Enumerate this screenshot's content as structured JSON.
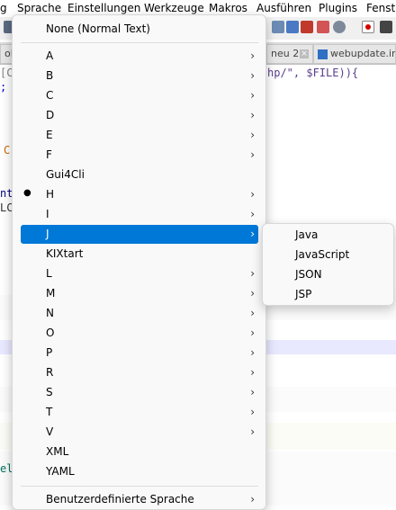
{
  "menubar": [
    "g",
    "Sprache",
    "Einstellungen",
    "Werkzeuge",
    "Makros",
    "Ausführen",
    "Plugins",
    "Fenste"
  ],
  "tabs": [
    {
      "label": "ole"
    },
    {
      "label": "neu 2"
    },
    {
      "label": "webupdate.ino"
    }
  ],
  "editor_lines": [
    {
      "text": "[C",
      "color": "#808080"
    },
    {
      "text": ";",
      "color": "#0000cc"
    },
    {
      "text": "hp/\", $FILE)){",
      "color": "#5a3f8c"
    },
    {
      "text": "C",
      "color": "#cc6600"
    },
    {
      "text": "nt",
      "color": "#000080"
    },
    {
      "text": "LC",
      "color": "#333333"
    },
    {
      "text": "el",
      "color": "#007060"
    }
  ],
  "language_menu": {
    "top_item": "None (Normal Text)",
    "items": [
      {
        "label": "A",
        "submenu": true
      },
      {
        "label": "B",
        "submenu": true
      },
      {
        "label": "C",
        "submenu": true
      },
      {
        "label": "D",
        "submenu": true
      },
      {
        "label": "E",
        "submenu": true
      },
      {
        "label": "F",
        "submenu": true
      },
      {
        "label": "Gui4Cli",
        "submenu": false
      },
      {
        "label": "H",
        "submenu": true,
        "checked": true
      },
      {
        "label": "I",
        "submenu": true
      },
      {
        "label": "J",
        "submenu": true,
        "highlighted": true
      },
      {
        "label": "KIXtart",
        "submenu": false
      },
      {
        "label": "L",
        "submenu": true
      },
      {
        "label": "M",
        "submenu": true
      },
      {
        "label": "N",
        "submenu": true
      },
      {
        "label": "O",
        "submenu": true
      },
      {
        "label": "P",
        "submenu": true
      },
      {
        "label": "R",
        "submenu": true
      },
      {
        "label": "S",
        "submenu": true
      },
      {
        "label": "T",
        "submenu": true
      },
      {
        "label": "V",
        "submenu": true
      },
      {
        "label": "XML",
        "submenu": false
      },
      {
        "label": "YAML",
        "submenu": false
      }
    ],
    "bottom_item": "Benutzerdefinierte Sprache",
    "submenu_arrow": "›",
    "check_bullet": "●"
  },
  "j_submenu": [
    "Java",
    "JavaScript",
    "JSON",
    "JSP"
  ],
  "colors": {
    "highlight": "#0078d7",
    "current_line": "#e8e8ff",
    "menu_bg": "#f9f9f9"
  }
}
